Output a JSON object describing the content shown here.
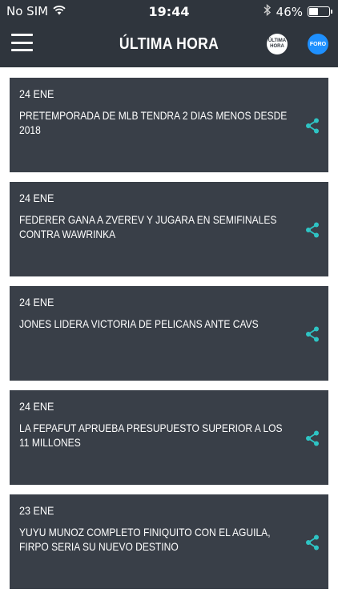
{
  "status_bar": {
    "carrier": "No SIM",
    "time": "19:44",
    "battery_percent": "46%",
    "battery_level": 0.46
  },
  "header": {
    "title": "ÚLTIMA HORA",
    "logo_ultima_line1": "ÚLTIMA",
    "logo_ultima_line2": "HORA",
    "logo_foro": "FORO"
  },
  "icons": {
    "menu": "hamburger-menu-icon",
    "share": "share-icon",
    "wifi": "wifi-icon",
    "bluetooth": "bluetooth-icon",
    "battery": "battery-icon"
  },
  "colors": {
    "bar_background": "#2f353d",
    "card_background": "#393f48",
    "share_accent": "#2ec4c4",
    "foro_blue": "#1e90ff"
  },
  "news": [
    {
      "date": "24 ENE",
      "headline": "PRETEMPORADA DE MLB TENDRA 2 DIAS MENOS DESDE 2018"
    },
    {
      "date": "24 ENE",
      "headline": "FEDERER GANA A ZVEREV Y JUGARA EN SEMIFINALES CONTRA WAWRINKA"
    },
    {
      "date": "24 ENE",
      "headline": "JONES LIDERA VICTORIA DE PELICANS ANTE CAVS"
    },
    {
      "date": "24 ENE",
      "headline": "LA FEPAFUT APRUEBA PRESUPUESTO SUPERIOR A LOS 11 MILLONES"
    },
    {
      "date": "23 ENE",
      "headline": "YUYU MUNOZ COMPLETO FINIQUITO CON EL AGUILA, FIRPO SERIA SU NUEVO DESTINO"
    }
  ]
}
